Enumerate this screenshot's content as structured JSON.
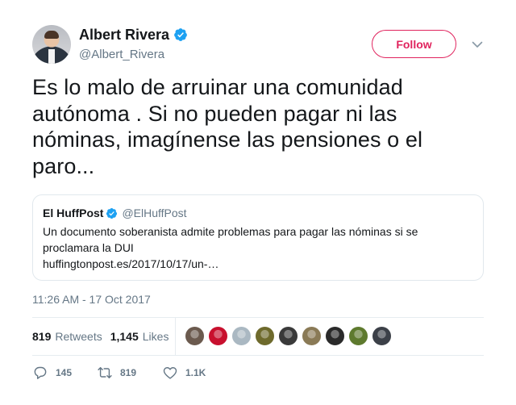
{
  "user": {
    "display_name": "Albert Rivera",
    "handle": "@Albert_Rivera"
  },
  "follow_label": "Follow",
  "tweet_text": "Es lo malo de arruinar una comunidad autónoma . Si no pueden pagar ni las nóminas, imagínense las pensiones o el paro...",
  "quote": {
    "name": "El HuffPost",
    "handle": "@ElHuffPost",
    "text": "Un documento soberanista admite problemas para pagar las nóminas si se proclamara la DUI",
    "link": "huffingtonpost.es/2017/10/17/un-…"
  },
  "timestamp": "11:26 AM - 17 Oct 2017",
  "stats": {
    "retweets_count": "819",
    "retweets_label": "Retweets",
    "likes_count": "1,145",
    "likes_label": "Likes"
  },
  "actions": {
    "reply_count": "145",
    "retweet_count": "819",
    "like_count": "1.1K"
  },
  "colors": {
    "accent": "#e0245e",
    "verified": "#1da1f2",
    "muted": "#657786"
  },
  "liker_avatars": [
    "#6b5a4e",
    "#c8102e",
    "#aab8c2",
    "#6e6a2c",
    "#3a3a3a",
    "#8a7a56",
    "#2a2a2a",
    "#5e7a2e",
    "#3c4048"
  ]
}
